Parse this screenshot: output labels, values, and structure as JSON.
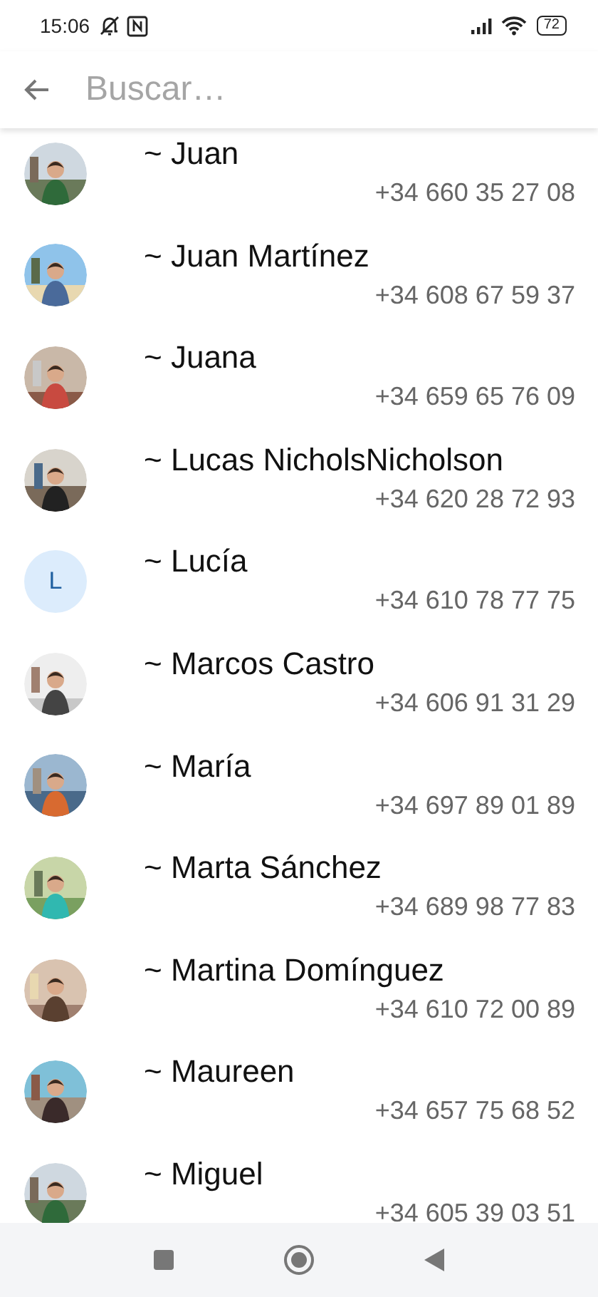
{
  "status_bar": {
    "time": "15:06",
    "battery": "72"
  },
  "search": {
    "placeholder": "Buscar…"
  },
  "contacts": [
    {
      "name": "~ Juan",
      "phone": "+34 660 35 27 08"
    },
    {
      "name": "~ Juan Martínez",
      "phone": "+34 608 67 59 37"
    },
    {
      "name": "~ Juana",
      "phone": "+34 659 65 76 09"
    },
    {
      "name": "~ Lucas NicholsNicholson",
      "phone": "+34 620 28 72 93"
    },
    {
      "name": "~ Lucía",
      "phone": "+34 610 78 77 75",
      "avatar": {
        "kind": "initial",
        "letter": "L"
      }
    },
    {
      "name": "~ Marcos Castro",
      "phone": "+34 606 91 31 29"
    },
    {
      "name": "~ María",
      "phone": "+34 697 89 01 89"
    },
    {
      "name": "~ Marta Sánchez",
      "phone": "+34 689 98 77 83"
    },
    {
      "name": "~ Martina Domínguez",
      "phone": "+34 610 72 00 89"
    },
    {
      "name": "~ Maureen",
      "phone": "+34 657 75 68 52"
    },
    {
      "name": "~ Miguel",
      "phone": "+34 605 39 03 51"
    }
  ]
}
